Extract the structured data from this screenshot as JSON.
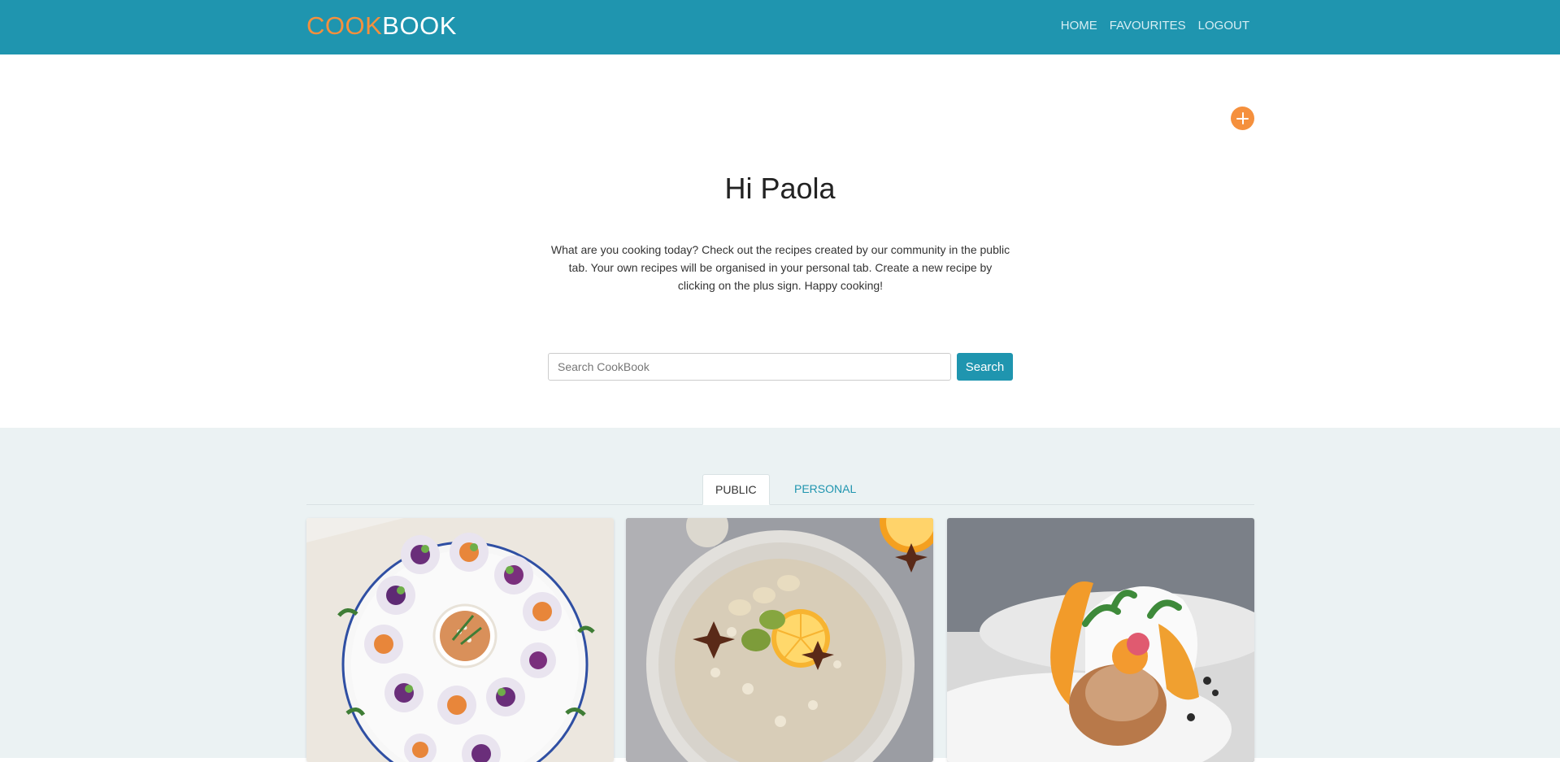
{
  "brand": {
    "part1": "COOK",
    "part2": "BOOK"
  },
  "nav": {
    "home": "HOME",
    "favourites": "FAVOURITES",
    "logout": "LOGOUT"
  },
  "hero": {
    "greeting": "Hi Paola",
    "intro": "What are you cooking today? Check out the recipes created by our community in the public tab. Your own recipes will be organised in your personal tab. Create a new recipe by clicking on the plus sign. Happy cooking!",
    "add_icon": "plus-icon"
  },
  "search": {
    "placeholder": "Search CookBook",
    "button_label": "Search"
  },
  "tabs": [
    {
      "label": "PUBLIC",
      "active": true
    },
    {
      "label": "PERSONAL",
      "active": false
    }
  ],
  "colors": {
    "primary": "#1f95af",
    "accent": "#f5903d",
    "section_bg": "#ebf2f3"
  }
}
